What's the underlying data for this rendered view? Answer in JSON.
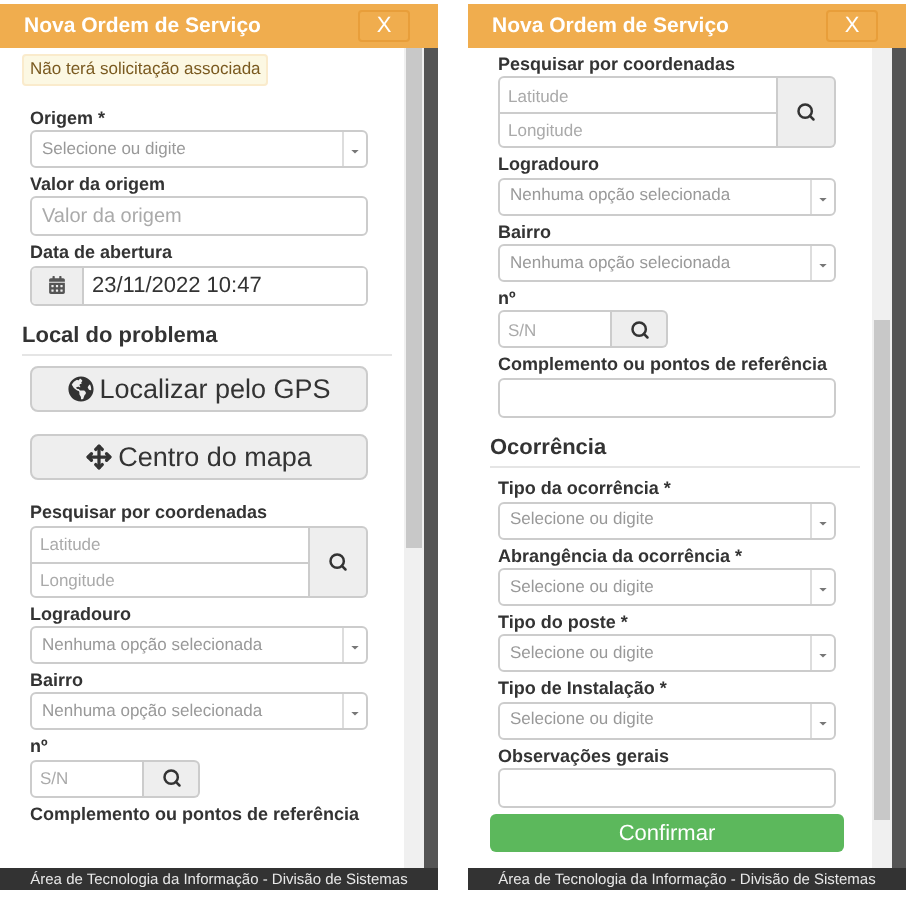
{
  "screens": [
    {
      "header": {
        "title": "Nova Ordem de Serviço",
        "close": "X"
      },
      "items": [
        {
          "kind": "notice",
          "text": "Não terá solicitação associada"
        },
        {
          "kind": "select",
          "label": "Origem *",
          "placeholder": "Selecione ou digite"
        },
        {
          "kind": "input",
          "label": "Valor da origem",
          "placeholder": "Valor da origem"
        },
        {
          "kind": "datetime",
          "label": "Data de abertura",
          "value": "23/11/2022 10:47"
        },
        {
          "kind": "section",
          "title": "Local do problema"
        },
        {
          "kind": "gps",
          "label": "Localizar pelo GPS"
        },
        {
          "kind": "center",
          "label": "Centro do mapa"
        },
        {
          "kind": "coords",
          "label": "Pesquisar por coordenadas",
          "latitude": {
            "placeholder": "Latitude"
          },
          "longitude": {
            "placeholder": "Longitude"
          }
        },
        {
          "kind": "select",
          "label": "Logradouro",
          "placeholder": "Nenhuma opção selecionada"
        },
        {
          "kind": "select",
          "label": "Bairro",
          "placeholder": "Nenhuma opção selecionada"
        },
        {
          "kind": "number",
          "label": "nº",
          "placeholder": "S/N"
        },
        {
          "kind": "label",
          "label": "Complemento ou pontos de referência"
        }
      ],
      "footer": "Área de Tecnologia da Informação - Divisão de Sistemas"
    },
    {
      "header": {
        "title": "Nova Ordem de Serviço",
        "close": "X"
      },
      "items": [
        {
          "kind": "coords",
          "label": "Pesquisar por coordenadas",
          "latitude": {
            "placeholder": "Latitude"
          },
          "longitude": {
            "placeholder": "Longitude"
          }
        },
        {
          "kind": "select",
          "label": "Logradouro",
          "placeholder": "Nenhuma opção selecionada"
        },
        {
          "kind": "select",
          "label": "Bairro",
          "placeholder": "Nenhuma opção selecionada"
        },
        {
          "kind": "number",
          "label": "nº",
          "placeholder": "S/N"
        },
        {
          "kind": "text",
          "label": "Complemento ou pontos de referência"
        },
        {
          "kind": "section",
          "title": "Ocorrência"
        },
        {
          "kind": "select",
          "label": "Tipo da ocorrência *",
          "placeholder": "Selecione ou digite"
        },
        {
          "kind": "select",
          "label": "Abrangência da ocorrência *",
          "placeholder": "Selecione ou digite"
        },
        {
          "kind": "select",
          "label": "Tipo do poste *",
          "placeholder": "Selecione ou digite"
        },
        {
          "kind": "select",
          "label": "Tipo de Instalação *",
          "placeholder": "Selecione ou digite"
        },
        {
          "kind": "text",
          "label": "Observações gerais"
        },
        {
          "kind": "confirm",
          "label": "Confirmar"
        }
      ],
      "footer": "Área de Tecnologia da Informação - Divisão de Sistemas"
    }
  ]
}
